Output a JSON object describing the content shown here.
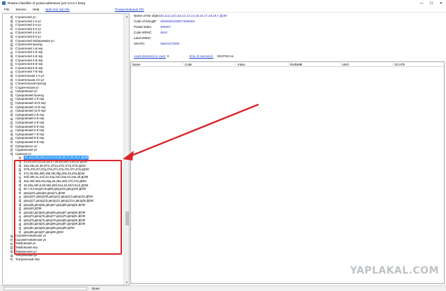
{
  "window": {
    "title": "Russia Classifier of postal addresses (ver.4.0.6.1 beta)",
    "controls": [
      "—",
      "☐",
      "✕"
    ]
  },
  "menu": {
    "items": [
      "File",
      "Service",
      "Help"
    ],
    "links": [
      "Split and Join file",
      "Пожертвования ПО"
    ]
  },
  "tree": {
    "rows": [
      {
        "text": "Строителей ул",
        "level": 1
      },
      {
        "text": "Строителей 1-я ул",
        "level": 1
      },
      {
        "text": "Строителей 2-я ул",
        "level": 1
      },
      {
        "text": "Строителей 3-я ул",
        "level": 1
      },
      {
        "text": "Строителей 4-я ул",
        "level": 1
      },
      {
        "text": "Строителей 5-я ул",
        "level": 1
      },
      {
        "text": "Строителей Набережная ул",
        "level": 1
      },
      {
        "text": "Строителей проезд",
        "level": 1
      },
      {
        "text": "Строителей 1-й пер",
        "level": 1
      },
      {
        "text": "Строителей 2-й пер",
        "level": 1
      },
      {
        "text": "Строителей 3-й пер",
        "level": 1
      },
      {
        "text": "Строителей 4-й пер",
        "level": 1
      },
      {
        "text": "Строителей 5-й пер",
        "level": 1
      },
      {
        "text": "Строителей 6-й пер",
        "level": 1
      },
      {
        "text": "Строителей 7-й пер",
        "level": 1
      },
      {
        "text": "Строительная 1-я ул",
        "level": 1
      },
      {
        "text": "Строительная 2-я ул",
        "level": 1
      },
      {
        "text": "Строительный проезд",
        "level": 1
      },
      {
        "text": "Студенческая ул",
        "level": 1
      },
      {
        "text": "Суворовская ул",
        "level": 1
      },
      {
        "text": "Суворовский проезд",
        "level": 1
      },
      {
        "text": "Суворовский 1-й пер",
        "level": 1
      },
      {
        "text": "Суворовский 10-й пер",
        "level": 1
      },
      {
        "text": "Суворовский 11-й пер",
        "level": 1
      },
      {
        "text": "Суворовский 12-й пер",
        "level": 1
      },
      {
        "text": "Суворовский 2-й пер",
        "level": 1
      },
      {
        "text": "Суворовский 3-й пер",
        "level": 1
      },
      {
        "text": "Суворовский 4-й пер",
        "level": 1
      },
      {
        "text": "Суворовский 5-й пер",
        "level": 1
      },
      {
        "text": "Суворовский 6-й пер",
        "level": 1
      },
      {
        "text": "Суворовский 7-й пер",
        "level": 1
      },
      {
        "text": "Суворовский 8-й пер",
        "level": 1
      },
      {
        "text": "Суворовский 9-й пер",
        "level": 1
      },
      {
        "text": "Суворовское ул",
        "level": 1
      },
      {
        "text": "Судаковская ул",
        "level": 1
      },
      {
        "text": "Сумская ул",
        "level": 1
      },
      {
        "text": "10,11а,11б,11в,12,13,14,15,16,17,18,19,7 ДОМ",
        "level": 2,
        "selected": true
      },
      {
        "text": "21,22,22А,23,24,25,27,28,29,29А,3,30,32 ДОМ",
        "level": 2
      },
      {
        "text": "32а,33а,34,35,37/1,37/1а,37/2,37/3,37/5 ДОМ",
        "level": 2
      },
      {
        "text": "37/6,37в,37г,37д,37ж,37з,37и,37к,37л,37м ДОМ",
        "level": 2
      },
      {
        "text": "37п,38,39а,39б,39в,39г,39д,39е,40,40а ДОМ",
        "level": 2
      },
      {
        "text": "40б,40в,41,41б,42,42а,42б,43а,44,44а,45 ДОМ",
        "level": 2
      },
      {
        "text": "45а,45б,45в,45г,45д,46,46а,46б,47б,47в ДОМ",
        "level": 2
      },
      {
        "text": "48,48а,48б,5,50,50а,50б,51а,52,52/2,54,6 ДОМ",
        "level": 2
      },
      {
        "text": "60,7,8,9,влд23,влд98,двлд103,двлд105 ДОМ",
        "level": 2
      },
      {
        "text": "двлд101,двлд53,двлд71 ДОМ",
        "level": 2
      },
      {
        "text": "двлд107,двлд109,двлд111,двлд113,двлд115 ДОМ",
        "level": 2
      },
      {
        "text": "двлд117,двлд119,двлд121,двлд121А,двлд39 ДОМ",
        "level": 2
      },
      {
        "text": "двлд35,двлд55,двлд57,двлд59,двлд60 ДОМ",
        "level": 2
      },
      {
        "text": "двлд43 ДОМ",
        "level": 2
      },
      {
        "text": "двлд61,двлд63,двлд65,двлд67,двлд69 ДОМ",
        "level": 2
      },
      {
        "text": "двлд73,двлд75,двлд77,двлд79,двлд81 ДОМ",
        "level": 2
      },
      {
        "text": "двлд75,двлд76,двлд78,двлд83,двлд85 ДОМ",
        "level": 2
      },
      {
        "text": "двлд82,двлд84,двлд86,двлд87,двлд89 ДОМ",
        "level": 2
      },
      {
        "text": "двлд91,двлд93,двлд95,двлд99 ДОМ",
        "level": 2
      },
      {
        "text": "двлд95,двлд97,двлд99 ДОМ",
        "level": 2
      },
      {
        "text": "Сыромятниковская ул",
        "level": 1
      },
      {
        "text": "Сыромятниковская ул",
        "level": 1
      },
      {
        "text": "Тамбовский ул",
        "level": 1
      },
      {
        "text": "Тамбовский пер",
        "level": 1
      },
      {
        "text": "Таможенная ул",
        "level": 1
      },
      {
        "text": "Театральная ул",
        "level": 1
      },
      {
        "text": "Театральный пер",
        "level": 1
      }
    ]
  },
  "info": {
    "fields": [
      {
        "label": "Name of the object:",
        "value": "10,11а,11б,11в,12,13,14,15,16,17,18,19,7 ДОМ"
      },
      {
        "label": "Code of КЛАДР:",
        "value": "46000001000074000001"
      },
      {
        "label": "Postal index:",
        "value": "305007"
      },
      {
        "label": "Code ИФНС:",
        "value": "4632"
      },
      {
        "label": "Land ИФНС:",
        "value": ""
      },
      {
        "label": "ОКАТО:",
        "value": "38401373000"
      }
    ],
    "count_label": "count elements in rows:",
    "count_value": "0",
    "time_label": "time of execution:",
    "time_value": "93,0733 ms"
  },
  "grid": {
    "columns": [
      "Name",
      "Code",
      "Index",
      "GNINMB",
      "UNO",
      "OCATD"
    ]
  },
  "status": {
    "text": "Done"
  },
  "watermark": {
    "text": "YAPLAKAL.COM"
  },
  "colors": {
    "selection": "#3399ff",
    "annotation": "#d9252a",
    "value_text": "#2b2bc4"
  }
}
